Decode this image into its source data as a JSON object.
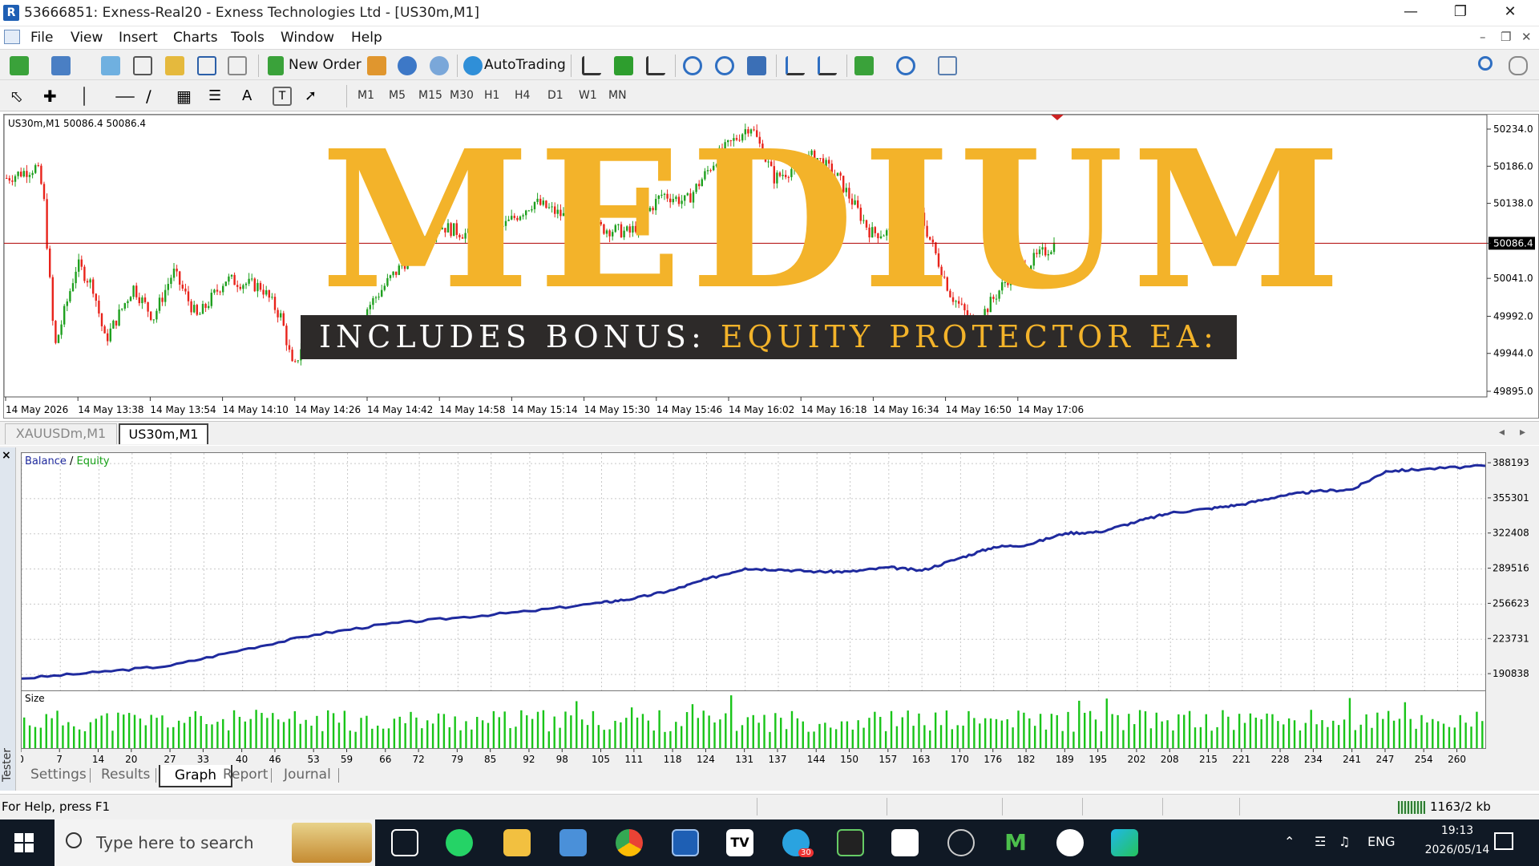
{
  "window": {
    "title": "53666851: Exness-Real20 - Exness Technologies Ltd - [US30m,M1]",
    "app_icon": "metatrader-icon",
    "controls": [
      "minimize",
      "maximize",
      "close"
    ]
  },
  "menu": {
    "items": [
      "File",
      "View",
      "Insert",
      "Charts",
      "Tools",
      "Window",
      "Help"
    ]
  },
  "toolbar": {
    "new_order_label": "New Order",
    "autotrading_label": "AutoTrading",
    "timeframes": [
      "M1",
      "M5",
      "M15",
      "M30",
      "H1",
      "H4",
      "D1",
      "W1",
      "MN"
    ]
  },
  "chart": {
    "header": "US30m,M1  50086.4 50086.4",
    "price_labels": [
      "50234.0",
      "50186.0",
      "50138.0",
      "50086.4",
      "50041.0",
      "49992.0",
      "49944.0",
      "49895.0"
    ],
    "current_price": "50086.4",
    "time_labels": [
      "14 May 2026",
      "14 May 13:38",
      "14 May 13:54",
      "14 May 14:10",
      "14 May 14:26",
      "14 May 14:42",
      "14 May 14:58",
      "14 May 15:14",
      "14 May 15:30",
      "14 May 15:46",
      "14 May 16:02",
      "14 May 16:18",
      "14 May 16:34",
      "14 May 16:50",
      "14 May 17:06"
    ],
    "colors": {
      "bull": "#1fa01f",
      "bear": "#e8231b",
      "price_line": "#b00000"
    }
  },
  "overlay": {
    "title": "MEDIUM",
    "banner_prefix": "INCLUDES BONUS: ",
    "banner_highlight": "EQUITY PROTECTOR EA:",
    "colors": {
      "gold": "#f3b32a",
      "banner_bg": "#2d2a29"
    }
  },
  "chart_tabs": [
    "XAUUSDm,M1",
    "US30m,M1"
  ],
  "active_chart_tab": "US30m,M1",
  "tester": {
    "side_label": "Tester",
    "legend_balance": "Balance",
    "legend_sep": " / ",
    "legend_equity": "Equity",
    "size_label": "Size",
    "y_labels": [
      "388193",
      "355301",
      "322408",
      "289516",
      "256623",
      "223731",
      "190838"
    ],
    "x_labels": [
      "0",
      "7",
      "14",
      "20",
      "27",
      "33",
      "40",
      "46",
      "53",
      "59",
      "66",
      "72",
      "79",
      "85",
      "92",
      "98",
      "105",
      "111",
      "118",
      "124",
      "131",
      "137",
      "144",
      "150",
      "157",
      "163",
      "170",
      "176",
      "182",
      "189",
      "195",
      "202",
      "208",
      "215",
      "221",
      "228",
      "234",
      "241",
      "247",
      "254",
      "260"
    ],
    "tabs": [
      "Settings",
      "Results",
      "Graph",
      "Report",
      "Journal"
    ],
    "active_tab": "Graph"
  },
  "chart_data": {
    "type": "line",
    "title": "",
    "xlabel": "",
    "ylabel": "",
    "x_range": [
      0,
      265
    ],
    "ylim": [
      174400,
      398000
    ],
    "series": [
      {
        "name": "Balance",
        "x": [
          0,
          14,
          27,
          40,
          53,
          66,
          79,
          92,
          105,
          111,
          118,
          124,
          131,
          137,
          144,
          150,
          157,
          163,
          170,
          176,
          182,
          189,
          195,
          202,
          208,
          215,
          221,
          228,
          234,
          241,
          247,
          254,
          265
        ],
        "values": [
          187000,
          193000,
          199000,
          214000,
          228000,
          238000,
          244000,
          250000,
          258000,
          262000,
          270000,
          280000,
          290000,
          289000,
          287000,
          287000,
          291000,
          288000,
          300000,
          310000,
          312000,
          323000,
          324000,
          334000,
          342000,
          346000,
          350000,
          358000,
          362000,
          364000,
          381000,
          383000,
          386000
        ]
      }
    ],
    "size_bars_note": "",
    "grid": true,
    "colors": {
      "balance": "#1f2a9e",
      "equity": "#17a117",
      "size_bar": "#19c419"
    }
  },
  "statusbar": {
    "help": "For Help, press F1",
    "traffic": "1163/2 kb"
  },
  "taskbar": {
    "search_placeholder": "Type here to search",
    "language": "ENG",
    "time": "19:13",
    "date": "2026/05/14",
    "telegram_badge": "30"
  }
}
